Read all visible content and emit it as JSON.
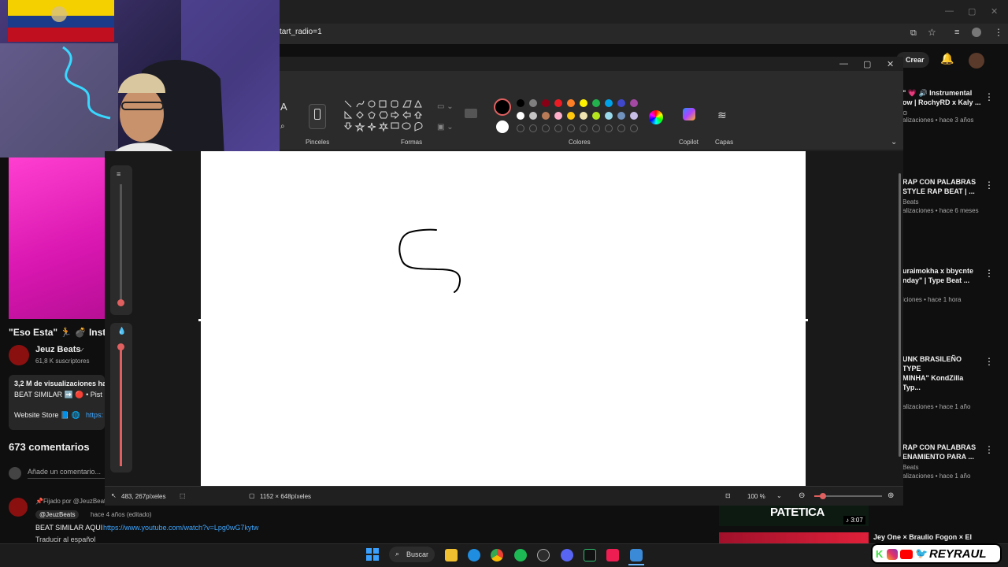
{
  "browser": {
    "url_fragment": "tart_radio=1",
    "create_label": "Crear"
  },
  "video": {
    "title": "\"Eso Esta\" 🏃 💣 Inst",
    "channel": "Jeuz Beats",
    "subscribers": "61,8 K suscriptores",
    "views_line": "3,2 M de visualizaciones  ha",
    "beat_line": "BEAT SIMILAR ➡️  🔴 • Pist",
    "website_line": "Website Store 📘 🌐",
    "link_fragment": "https:",
    "comments_count": "673 comentarios",
    "add_comment_placeholder": "Añade un comentario...",
    "pinned_label": "Fijado por @JeuzBeats",
    "comment_author": "@JeuzBeats",
    "comment_time": "hace 4 años (editado)",
    "comment_text_prefix": "BEAT SIMILAR AQUI",
    "comment_link": "https://www.youtube.com/watch?v=Lpg0wG7kytw",
    "translate_label": "Traducir al español"
  },
  "paint": {
    "groups": {
      "brushes": "Pinceles",
      "shapes": "Formas",
      "colors": "Colores",
      "copilot": "Copilot",
      "layers": "Capas"
    },
    "status_cursor": "483, 267píxeles",
    "status_size": "1152 × 648píxeles",
    "zoom": "100 %",
    "text_tool_icon": "A",
    "colors": {
      "row1": [
        "#000000",
        "#7f7f7f",
        "#880015",
        "#ed1c24",
        "#ff7f27",
        "#fff200",
        "#22b14c",
        "#00a2e8",
        "#3f48cc",
        "#a349a4"
      ],
      "row2": [
        "#ffffff",
        "#c3c3c3",
        "#b97a57",
        "#ffaec9",
        "#ffc90e",
        "#efe4b0",
        "#b5e61d",
        "#99d9ea",
        "#7092be",
        "#c8bfe7"
      ]
    }
  },
  "sidebar_videos": [
    {
      "title1": "\" 💗 🔊 Instrumental",
      "title2": "ow | RochyRD x Kaly ...",
      "meta": "alizaciones • hace 3 años",
      "channel": ""
    },
    {
      "title1": "RAP CON PALABRAS",
      "title2": "STYLE RAP BEAT | ...",
      "meta": "alizaciones • hace 6 meses",
      "channel": "Beats"
    },
    {
      "title1": "uraimokha x bbycnte",
      "title2": "nday\" | Type Beat ...",
      "meta": "iciones • hace 1 hora",
      "channel": ""
    },
    {
      "title1": "UNK BRASILEÑO TYPE",
      "title2": "MINHA\" KondZilla Typ...",
      "meta": "alizaciones • hace 1 año",
      "channel": ""
    },
    {
      "title1": "RAP CON PALABRAS",
      "title2": "ENAMIENTO PARA ...",
      "meta": "alizaciones • hace 1 año",
      "channel": "Beats"
    }
  ],
  "bottom_thumb": {
    "text": "PATETICA",
    "duration": "♪ 3:07",
    "next_title": "Jey One × Braulio Fogon × El"
  },
  "taskbar": {
    "search_label": "Buscar"
  },
  "overlay": {
    "handle": "REYRAUL"
  }
}
